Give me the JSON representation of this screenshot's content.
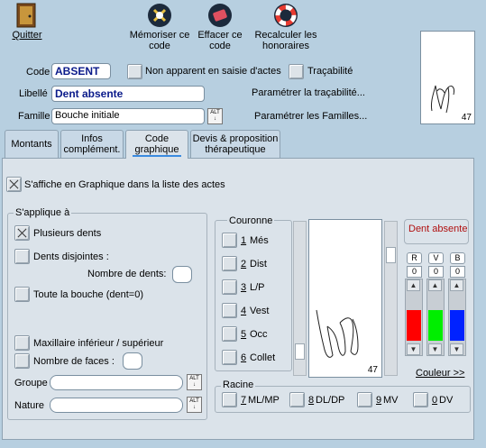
{
  "toolbar": {
    "quit": "Quitter",
    "memorize_line1": "Mémoriser ce",
    "memorize_line2": "code",
    "erase_line1": "Effacer ce",
    "erase_line2": "code",
    "recalc_line1": "Recalculer les",
    "recalc_line2": "honoraires"
  },
  "form": {
    "code_label": "Code",
    "code_value": "ABSENT",
    "non_apparent_label": "Non apparent en saisie d'actes",
    "tracabilite_label": "Traçabilité",
    "libelle_label": "Libellé",
    "libelle_value": "Dent absente",
    "param_tracabilite": "Paramétrer la traçabilité...",
    "famille_label": "Famille",
    "famille_value": "Bouche initiale",
    "param_familles": "Paramétrer les Familles...",
    "alt_label": "ALT"
  },
  "tooth_number": "47",
  "tabs": [
    {
      "line1": "Montants",
      "line2": ""
    },
    {
      "line1": "Infos",
      "line2": "complément."
    },
    {
      "line1": "Code",
      "line2": "graphique"
    },
    {
      "line1": "Devis & proposition",
      "line2": "thérapeutique"
    }
  ],
  "panel": {
    "affiche_label": "S'affiche en Graphique dans la liste des actes",
    "applique_title": "S'applique à",
    "plusieurs_dents": "Plusieurs dents",
    "dents_disjointes": "Dents disjointes :",
    "nombre_dents": "Nombre de dents:",
    "toute_bouche": "Toute la bouche (dent=0)",
    "maxillaire": "Maxillaire inférieur / supérieur",
    "nombre_faces": "Nombre de faces :",
    "groupe_label": "Groupe",
    "nature_label": "Nature",
    "couronne_title": "Couronne",
    "couronne_items": [
      {
        "key": "1",
        "label": "Més"
      },
      {
        "key": "2",
        "label": "Dist"
      },
      {
        "key": "3",
        "label": "L/P"
      },
      {
        "key": "4",
        "label": "Vest"
      },
      {
        "key": "5",
        "label": "Occ"
      },
      {
        "key": "6",
        "label": "Collet"
      }
    ],
    "racine_title": "Racine",
    "racine_items": [
      {
        "key": "7",
        "label": "ML/MP"
      },
      {
        "key": "8",
        "label": "DL/DP"
      },
      {
        "key": "9",
        "label": "MV"
      },
      {
        "key": "0",
        "label": "DV"
      }
    ],
    "dent_absente_label": "Dent absente",
    "rgb_labels": [
      "R",
      "V",
      "B"
    ],
    "rgb_values": [
      "0",
      "0",
      "0"
    ],
    "couleur_link": "Couleur >>",
    "colors": {
      "r": "#ff0000",
      "v": "#00ee00",
      "b": "#0022ff",
      "accent_text": "#b01010"
    }
  }
}
